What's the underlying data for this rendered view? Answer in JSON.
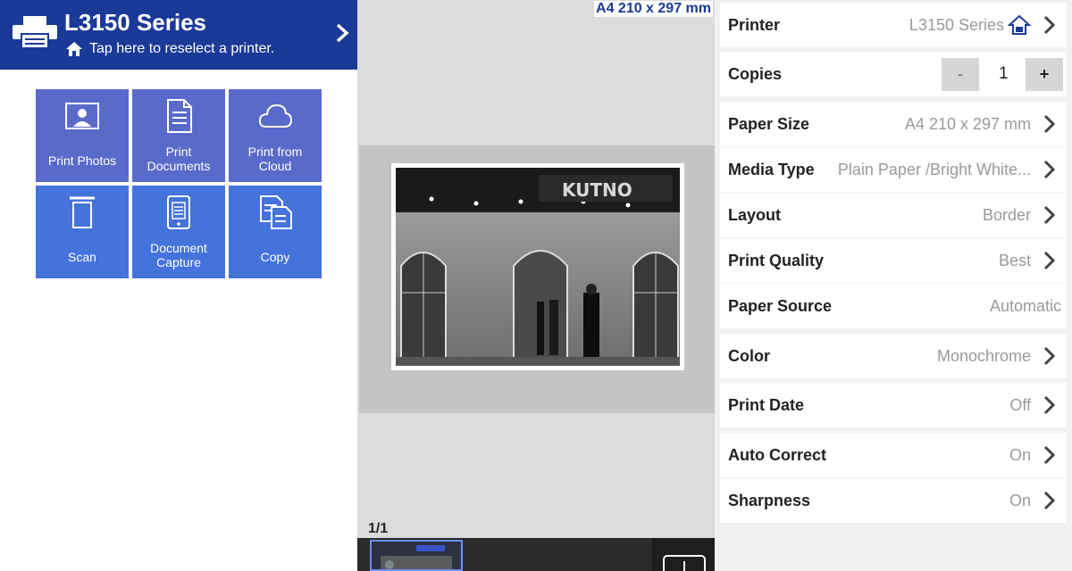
{
  "header": {
    "printer_name": "L3150 Series",
    "subtitle": "Tap here to reselect a printer."
  },
  "tiles": [
    {
      "label_line1": "Print Photos",
      "label_line2": "",
      "icon": "photo-icon"
    },
    {
      "label_line1": "Print",
      "label_line2": "Documents",
      "icon": "document-icon"
    },
    {
      "label_line1": "Print from",
      "label_line2": "Cloud",
      "icon": "cloud-icon"
    },
    {
      "label_line1": "Scan",
      "label_line2": "",
      "icon": "scan-icon"
    },
    {
      "label_line1": "Document",
      "label_line2": "Capture",
      "icon": "phone-document-icon"
    },
    {
      "label_line1": "Copy",
      "label_line2": "",
      "icon": "copy-icon"
    }
  ],
  "preview": {
    "paper_label": "A4 210 x 297 mm",
    "page_counter": "1/1",
    "photo_sign": "KUTNO"
  },
  "settings": {
    "printer": {
      "label": "Printer",
      "value": "L3150 Series"
    },
    "copies": {
      "label": "Copies",
      "value": "1",
      "minus": "-",
      "plus": "+"
    },
    "paper_size": {
      "label": "Paper Size",
      "value": "A4 210 x 297 mm"
    },
    "media_type": {
      "label": "Media Type",
      "value": "Plain Paper /Bright White..."
    },
    "layout": {
      "label": "Layout",
      "value": "Border"
    },
    "print_quality": {
      "label": "Print Quality",
      "value": "Best"
    },
    "paper_source": {
      "label": "Paper Source",
      "value": "Automatic"
    },
    "color": {
      "label": "Color",
      "value": "Monochrome"
    },
    "print_date": {
      "label": "Print Date",
      "value": "Off"
    },
    "auto_correct": {
      "label": "Auto Correct",
      "value": "On"
    },
    "sharpness": {
      "label": "Sharpness",
      "value": "On"
    }
  },
  "colors": {
    "header_blue": "#1b3997",
    "tile_purple": "#5a6acb",
    "tile_blue": "#4573dc"
  }
}
